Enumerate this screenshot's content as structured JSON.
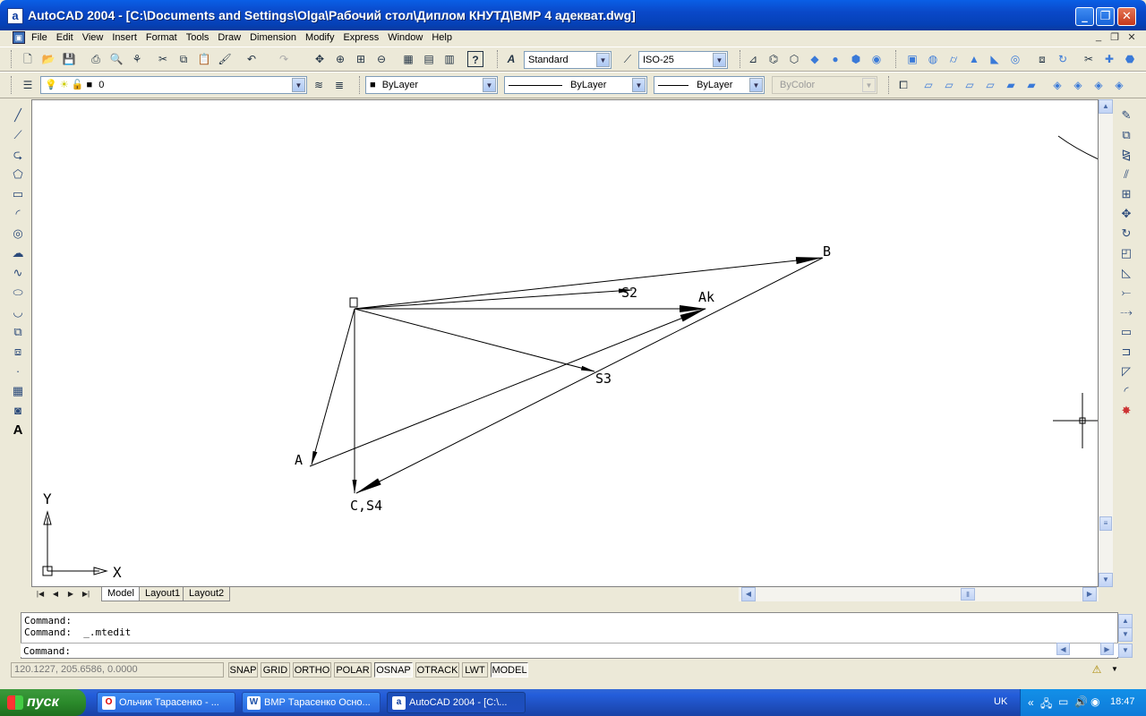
{
  "window": {
    "title": "AutoCAD 2004 - [C:\\Documents and Settings\\Olga\\Рабочий стол\\Диплом КНУТД\\ВМР 4 адекват.dwg]",
    "app_icon": "a"
  },
  "menu": [
    "File",
    "Edit",
    "View",
    "Insert",
    "Format",
    "Tools",
    "Draw",
    "Dimension",
    "Modify",
    "Express",
    "Window",
    "Help"
  ],
  "toolbar": {
    "text_style": "Standard",
    "dim_style": "ISO-25",
    "layer": "0",
    "color": "ByLayer",
    "linetype": "ByLayer",
    "lineweight": "ByLayer",
    "plotstyle": "ByColor"
  },
  "drawing": {
    "labels": {
      "B": "B",
      "S2": "S2",
      "Ak": "Ak",
      "S3": "S3",
      "A": "A",
      "CS4": "C,S4",
      "Y": "Y",
      "X": "X"
    }
  },
  "tabs": [
    "Model",
    "Layout1",
    "Layout2"
  ],
  "command": {
    "history": [
      "Command:",
      "Command:  _.mtedit"
    ],
    "prompt": "Command:"
  },
  "status": {
    "coords": "120.1227, 205.6586, 0.0000",
    "toggles": [
      {
        "label": "SNAP",
        "on": false
      },
      {
        "label": "GRID",
        "on": false
      },
      {
        "label": "ORTHO",
        "on": false
      },
      {
        "label": "POLAR",
        "on": false
      },
      {
        "label": "OSNAP",
        "on": true
      },
      {
        "label": "OTRACK",
        "on": false
      },
      {
        "label": "LWT",
        "on": false
      },
      {
        "label": "MODEL",
        "on": true
      }
    ]
  },
  "taskbar": {
    "start": "пуск",
    "tasks": [
      {
        "label": "Ольчик Тарасенко - ...",
        "icon": "opera-icon",
        "active": false
      },
      {
        "label": "ВМР Тарасенко Осно...",
        "icon": "word-icon",
        "active": false
      },
      {
        "label": "AutoCAD 2004 - [C:\\...",
        "icon": "autocad-icon",
        "active": true
      }
    ],
    "lang": "UK",
    "clock": "18:47"
  }
}
